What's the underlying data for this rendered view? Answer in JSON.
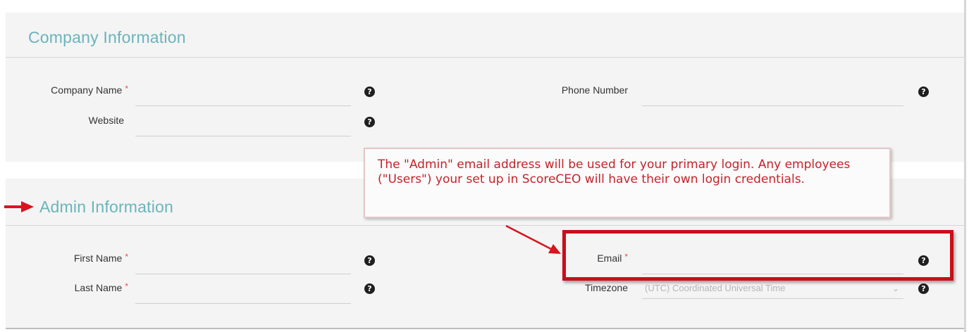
{
  "company": {
    "title": "Company Information",
    "company_name_label": "Company Name",
    "website_label": "Website",
    "phone_label": "Phone Number",
    "required_mark": "*"
  },
  "admin": {
    "title": "Admin Information",
    "first_name_label": "First Name",
    "last_name_label": "Last Name",
    "email_label": "Email",
    "timezone_label": "Timezone",
    "timezone_value": "(UTC) Coordinated Universal Time",
    "required_mark": "*"
  },
  "callout": {
    "text": "The \"Admin\" email address will be used for your primary login. Any employees (\"Users\") your set up in ScoreCEO will have their own login credentials."
  },
  "icons": {
    "help": "question-circle-icon",
    "dropdown": "chevron-down-icon",
    "arrow": "red-arrow-icon"
  },
  "colors": {
    "section_title": "#6bb4bb",
    "required": "#e05050",
    "annotation": "#c80f18",
    "callout_text": "#c4232a"
  }
}
